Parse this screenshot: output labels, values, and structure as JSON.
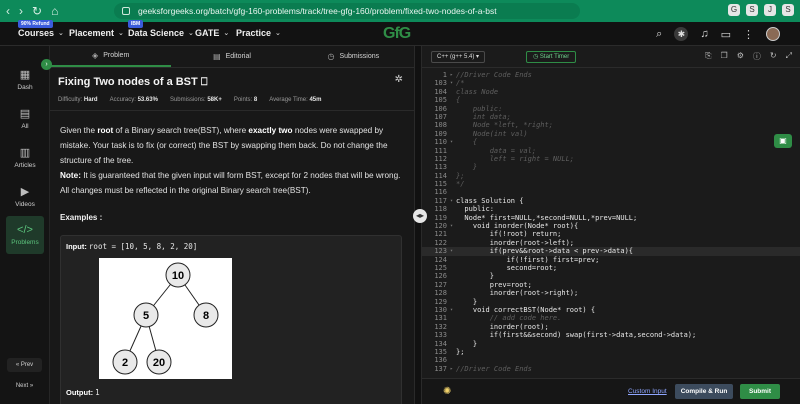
{
  "browser": {
    "url": "geeksforgeeks.org/batch/gfg-160-problems/track/tree-gfg-160/problem/fixed-two-nodes-of-a-bst",
    "extensions": [
      "G",
      "S",
      "J",
      "S"
    ]
  },
  "header": {
    "menu": [
      {
        "label": "Courses",
        "badge": "90% Refund"
      },
      {
        "label": "Placement",
        "badge": ""
      },
      {
        "label": "Data Science",
        "badge": "IBM"
      },
      {
        "label": "GATE",
        "badge": ""
      },
      {
        "label": "Practice",
        "badge": ""
      }
    ],
    "logo_text": "GfG",
    "accent": "#2f8d46"
  },
  "sidebar": {
    "items": [
      {
        "label": "Dash",
        "icon": "dashboard-icon"
      },
      {
        "label": "All",
        "icon": "grid-icon"
      },
      {
        "label": "Articles",
        "icon": "article-icon"
      },
      {
        "label": "Videos",
        "icon": "video-icon"
      },
      {
        "label": "Problems",
        "icon": "code-icon"
      }
    ],
    "prev_label": "Prev",
    "next_label": "Next"
  },
  "problem": {
    "tabs": [
      "Problem",
      "Editorial",
      "Submissions"
    ],
    "title": "Fixing Two nodes of a BST",
    "meta": [
      {
        "key": "Difficulty:",
        "value": "Hard"
      },
      {
        "key": "Accuracy:",
        "value": "53.63%"
      },
      {
        "key": "Submissions:",
        "value": "58K+"
      },
      {
        "key": "Points:",
        "value": "8"
      },
      {
        "key": "Average Time:",
        "value": "45m"
      }
    ],
    "desc_parts": {
      "p1_a": "Given the ",
      "p1_b": "root",
      "p1_c": " of a Binary search tree(BST), where ",
      "p1_d": "exactly two",
      "p1_e": " nodes were swapped by mistake. Your task is to fix (or correct) the BST by swapping them back. Do not change the structure of the tree.",
      "note_label": "Note:",
      "note_text": " It is guaranteed that the given input will form BST, except for 2 nodes that will be wrong. All changes must be reflected in the original Binary search tree(BST)."
    },
    "examples_label": "Examples :",
    "example": {
      "input_label": "Input:",
      "input_value": "root = [10, 5, 8, 2, 20]",
      "output_label": "Output:",
      "output_value": "1"
    },
    "tree_nodes": [
      "10",
      "5",
      "8",
      "2",
      "20"
    ]
  },
  "editor": {
    "language": "C++ (g++ 5.4)",
    "timer_label": "Start Timer",
    "lines": [
      {
        "n": "1",
        "t": "//Driver Code Ends",
        "c": true,
        "fold": "▸"
      },
      {
        "n": "103",
        "t": "/*",
        "c": true,
        "fold": "▾"
      },
      {
        "n": "104",
        "t": "class Node",
        "c": true,
        "fold": ""
      },
      {
        "n": "105",
        "t": "{",
        "c": true,
        "fold": ""
      },
      {
        "n": "106",
        "t": "    public:",
        "c": true,
        "fold": ""
      },
      {
        "n": "107",
        "t": "    int data;",
        "c": true,
        "fold": ""
      },
      {
        "n": "108",
        "t": "    Node *left, *right;",
        "c": true,
        "fold": ""
      },
      {
        "n": "109",
        "t": "    Node(int val)",
        "c": true,
        "fold": ""
      },
      {
        "n": "110",
        "t": "    {",
        "c": true,
        "fold": "▾"
      },
      {
        "n": "111",
        "t": "        data = val;",
        "c": true,
        "fold": ""
      },
      {
        "n": "112",
        "t": "        left = right = NULL;",
        "c": true,
        "fold": ""
      },
      {
        "n": "113",
        "t": "    }",
        "c": true,
        "fold": ""
      },
      {
        "n": "114",
        "t": "};",
        "c": true,
        "fold": ""
      },
      {
        "n": "115",
        "t": "*/",
        "c": true,
        "fold": ""
      },
      {
        "n": "116",
        "t": "",
        "c": false,
        "fold": ""
      },
      {
        "n": "117",
        "t": "class Solution {",
        "c": false,
        "fold": "▾"
      },
      {
        "n": "118",
        "t": "  public:",
        "c": false,
        "fold": ""
      },
      {
        "n": "119",
        "t": "  Node* first=NULL,*second=NULL,*prev=NULL;",
        "c": false,
        "fold": ""
      },
      {
        "n": "120",
        "t": "    void inorder(Node* root){",
        "c": false,
        "fold": "▾"
      },
      {
        "n": "121",
        "t": "        if(!root) return;",
        "c": false,
        "fold": ""
      },
      {
        "n": "122",
        "t": "        inorder(root->left);",
        "c": false,
        "fold": ""
      },
      {
        "n": "123",
        "t": "        if(prev&&root->data < prev->data){",
        "c": false,
        "fold": "▾",
        "hl": true
      },
      {
        "n": "124",
        "t": "            if(!first) first=prev;",
        "c": false,
        "fold": ""
      },
      {
        "n": "125",
        "t": "            second=root;",
        "c": false,
        "fold": ""
      },
      {
        "n": "126",
        "t": "        }",
        "c": false,
        "fold": ""
      },
      {
        "n": "127",
        "t": "        prev=root;",
        "c": false,
        "fold": ""
      },
      {
        "n": "128",
        "t": "        inorder(root->right);",
        "c": false,
        "fold": ""
      },
      {
        "n": "129",
        "t": "    }",
        "c": false,
        "fold": ""
      },
      {
        "n": "130",
        "t": "    void correctBST(Node* root) {",
        "c": false,
        "fold": "▾"
      },
      {
        "n": "131",
        "t": "        // add code here.",
        "c": true,
        "fold": ""
      },
      {
        "n": "132",
        "t": "        inorder(root);",
        "c": false,
        "fold": ""
      },
      {
        "n": "133",
        "t": "        if(first&&second) swap(first->data,second->data);",
        "c": false,
        "fold": ""
      },
      {
        "n": "134",
        "t": "    }",
        "c": false,
        "fold": ""
      },
      {
        "n": "135",
        "t": "};",
        "c": false,
        "fold": ""
      },
      {
        "n": "136",
        "t": "",
        "c": false,
        "fold": ""
      },
      {
        "n": "137",
        "t": "//Driver Code Ends",
        "c": true,
        "fold": "▸"
      }
    ],
    "custom_input_label": "Custom Input",
    "compile_label": "Compile & Run",
    "submit_label": "Submit"
  }
}
